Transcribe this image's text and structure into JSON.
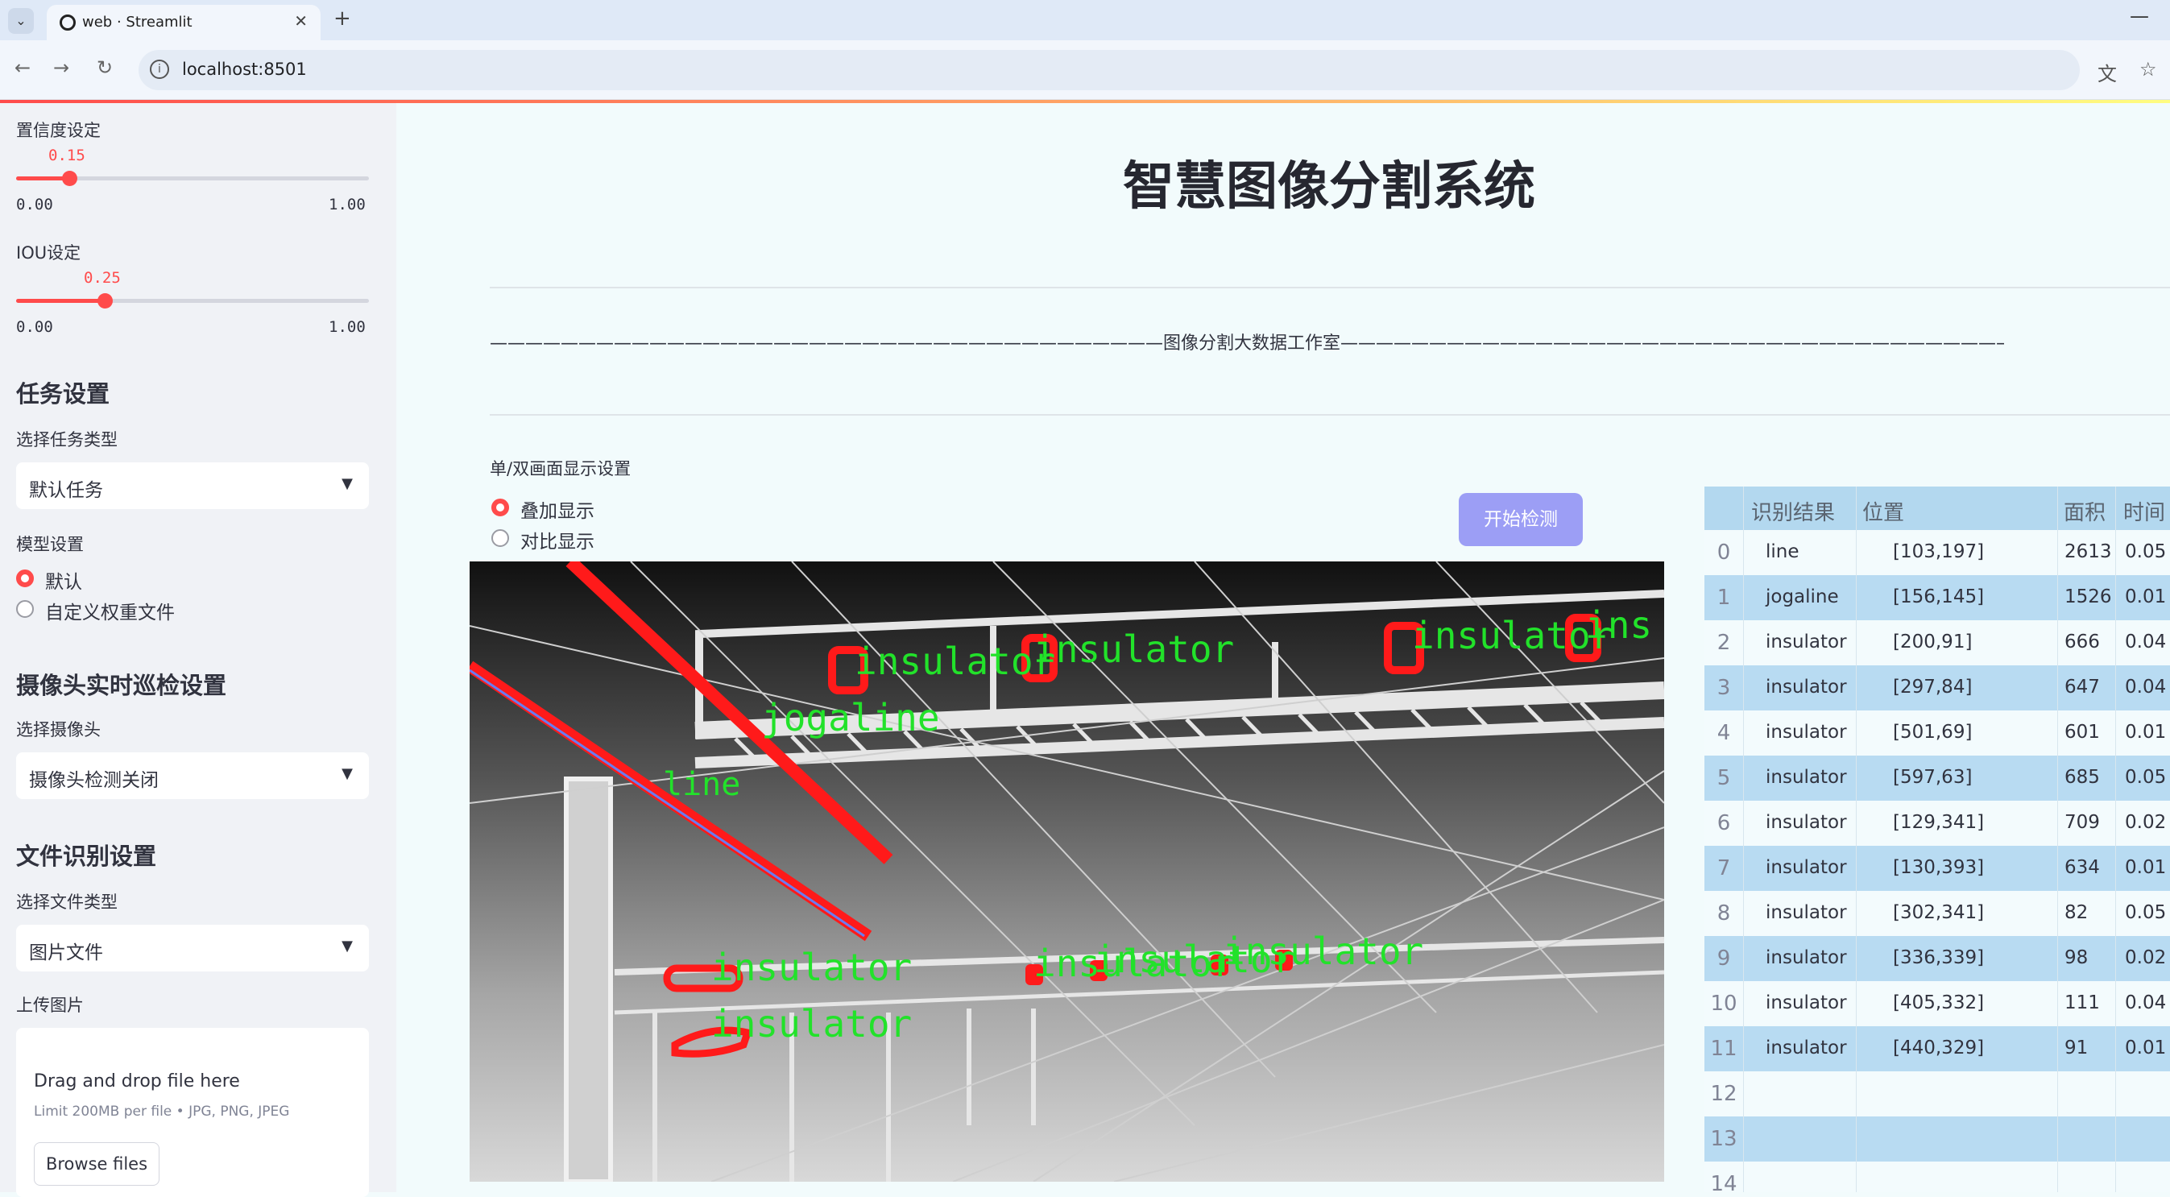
{
  "browser": {
    "tab_title": "web · Streamlit",
    "url": "localhost:8501",
    "new_tab": "+",
    "tab_close": "✕",
    "minimize": "—"
  },
  "sidebar": {
    "confidence": {
      "label": "置信度设定",
      "value": "0.15",
      "value_fraction": 0.15,
      "min": "0.00",
      "max": "1.00"
    },
    "iou": {
      "label": "IOU设定",
      "value": "0.25",
      "value_fraction": 0.25,
      "min": "0.00",
      "max": "1.00"
    },
    "task_heading": "任务设置",
    "task_type_label": "选择任务类型",
    "task_type_value": "默认任务",
    "model_label": "模型设置",
    "model_options": [
      "默认",
      "自定义权重文件"
    ],
    "camera_heading": "摄像头实时巡检设置",
    "camera_label": "选择摄像头",
    "camera_value": "摄像头检测关闭",
    "file_heading": "文件识别设置",
    "file_type_label": "选择文件类型",
    "file_type_value": "图片文件",
    "upload_label": "上传图片",
    "upload_title": "Drag and drop file here",
    "upload_hint": "Limit 200MB per file • JPG, PNG, JPEG",
    "browse_label": "Browse files"
  },
  "main": {
    "title": "智慧图像分割系统",
    "divider_text": "——————————————————————————————————————图像分割大数据工作室——————————————————————————————————————",
    "mode_label": "单/双画面显示设置",
    "mode_options": [
      "叠加显示",
      "对比显示"
    ],
    "start_button": "开始检测"
  },
  "detections_overlay": [
    "insulator",
    "insulator",
    "insulator",
    "ins",
    "jogaline",
    "line",
    "insulator",
    "insulator",
    "insulator",
    "insulator",
    "insulator"
  ],
  "table": {
    "headers": [
      "识别结果",
      "位置",
      "面积",
      "时间"
    ],
    "rows": [
      {
        "idx": "0",
        "label": "line",
        "pos": "[103,197]",
        "area": "2613",
        "time": "0.05"
      },
      {
        "idx": "1",
        "label": "jogaline",
        "pos": "[156,145]",
        "area": "1526",
        "time": "0.01"
      },
      {
        "idx": "2",
        "label": "insulator",
        "pos": "[200,91]",
        "area": "666",
        "time": "0.04"
      },
      {
        "idx": "3",
        "label": "insulator",
        "pos": "[297,84]",
        "area": "647",
        "time": "0.04"
      },
      {
        "idx": "4",
        "label": "insulator",
        "pos": "[501,69]",
        "area": "601",
        "time": "0.01"
      },
      {
        "idx": "5",
        "label": "insulator",
        "pos": "[597,63]",
        "area": "685",
        "time": "0.05"
      },
      {
        "idx": "6",
        "label": "insulator",
        "pos": "[129,341]",
        "area": "709",
        "time": "0.02"
      },
      {
        "idx": "7",
        "label": "insulator",
        "pos": "[130,393]",
        "area": "634",
        "time": "0.01"
      },
      {
        "idx": "8",
        "label": "insulator",
        "pos": "[302,341]",
        "area": "82",
        "time": "0.05"
      },
      {
        "idx": "9",
        "label": "insulator",
        "pos": "[336,339]",
        "area": "98",
        "time": "0.02"
      },
      {
        "idx": "10",
        "label": "insulator",
        "pos": "[405,332]",
        "area": "111",
        "time": "0.04"
      },
      {
        "idx": "11",
        "label": "insulator",
        "pos": "[440,329]",
        "area": "91",
        "time": "0.01"
      },
      {
        "idx": "12",
        "label": "",
        "pos": "",
        "area": "",
        "time": ""
      },
      {
        "idx": "13",
        "label": "",
        "pos": "",
        "area": "",
        "time": ""
      },
      {
        "idx": "14",
        "label": "",
        "pos": "",
        "area": "",
        "time": ""
      }
    ]
  },
  "colors": {
    "accent": "#ff4b4b",
    "button": "#9c9ef5",
    "mask": "#ff1a1a",
    "label": "#22e22a"
  }
}
